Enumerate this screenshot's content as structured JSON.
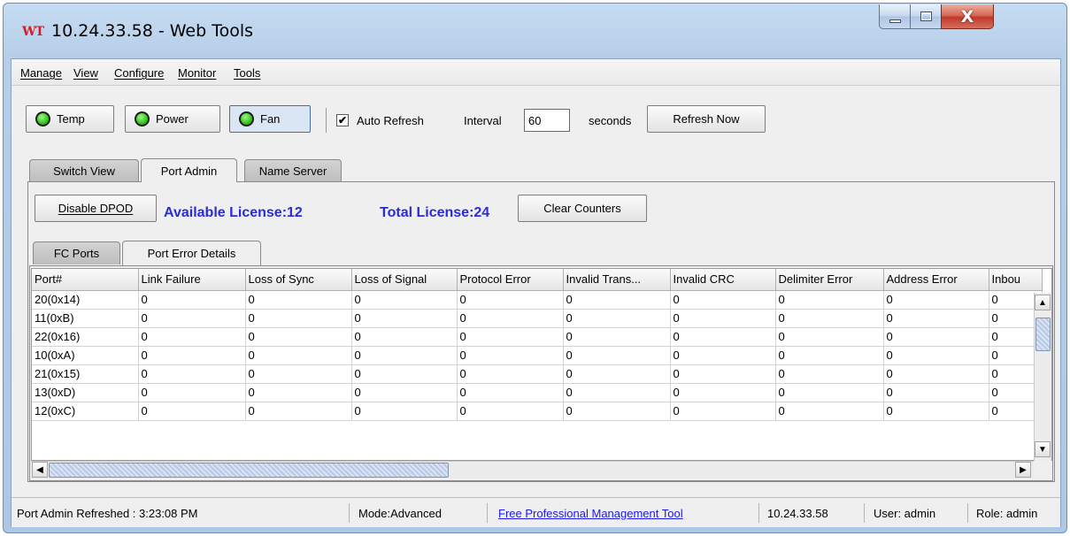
{
  "window": {
    "app_icon": "WT",
    "title": "10.24.33.58 - Web Tools"
  },
  "menu": [
    "Manage",
    "View",
    "Configure",
    "Monitor",
    "Tools"
  ],
  "toolbar": {
    "temp_label": "Temp",
    "power_label": "Power",
    "fan_label": "Fan",
    "auto_refresh_label": "Auto Refresh",
    "auto_refresh_checked": "✔",
    "interval_label": "Interval",
    "interval_value": "60",
    "seconds_label": "seconds",
    "refresh_now_label": "Refresh Now",
    "status_led_color": "#36c41a"
  },
  "tabs": [
    "Switch View",
    "Port Admin",
    "Name Server"
  ],
  "port_admin": {
    "disable_dpod_label": "Disable DPOD",
    "available_license": "Available License:12",
    "total_license": "Total License:24",
    "clear_counters_label": "Clear Counters",
    "license_color": "#2a2ad8"
  },
  "inner_tabs": [
    "FC Ports",
    "Port Error Details"
  ],
  "table": {
    "columns": [
      "Port#",
      "Link Failure",
      "Loss of Sync",
      "Loss of Signal",
      "Protocol Error",
      "Invalid Trans...",
      "Invalid CRC",
      "Delimiter Error",
      "Address Error",
      "Inbou"
    ],
    "rows": [
      [
        "20(0x14)",
        "0",
        "0",
        "0",
        "0",
        "0",
        "0",
        "0",
        "0",
        "0"
      ],
      [
        "11(0xB)",
        "0",
        "0",
        "0",
        "0",
        "0",
        "0",
        "0",
        "0",
        "0"
      ],
      [
        "22(0x16)",
        "0",
        "0",
        "0",
        "0",
        "0",
        "0",
        "0",
        "0",
        "0"
      ],
      [
        "10(0xA)",
        "0",
        "0",
        "0",
        "0",
        "0",
        "0",
        "0",
        "0",
        "0"
      ],
      [
        "21(0x15)",
        "0",
        "0",
        "0",
        "0",
        "0",
        "0",
        "0",
        "0",
        "0"
      ],
      [
        "13(0xD)",
        "0",
        "0",
        "0",
        "0",
        "0",
        "0",
        "0",
        "0",
        "0"
      ],
      [
        "12(0xC)",
        "0",
        "0",
        "0",
        "0",
        "0",
        "0",
        "0",
        "0",
        "0"
      ]
    ]
  },
  "statusbar": {
    "refreshed": "Port Admin Refreshed : 3:23:08 PM",
    "mode": "Mode:Advanced",
    "link": "Free Professional Management Tool",
    "ip": "10.24.33.58",
    "user": "User: admin",
    "role": "Role: admin"
  },
  "icons": {
    "minimize": "minimize-icon",
    "maximize": "maximize-icon",
    "close": "close-icon",
    "scroll_up": "arrow-up-icon",
    "scroll_down": "arrow-down-icon",
    "scroll_left": "arrow-left-icon",
    "scroll_right": "arrow-right-icon"
  }
}
